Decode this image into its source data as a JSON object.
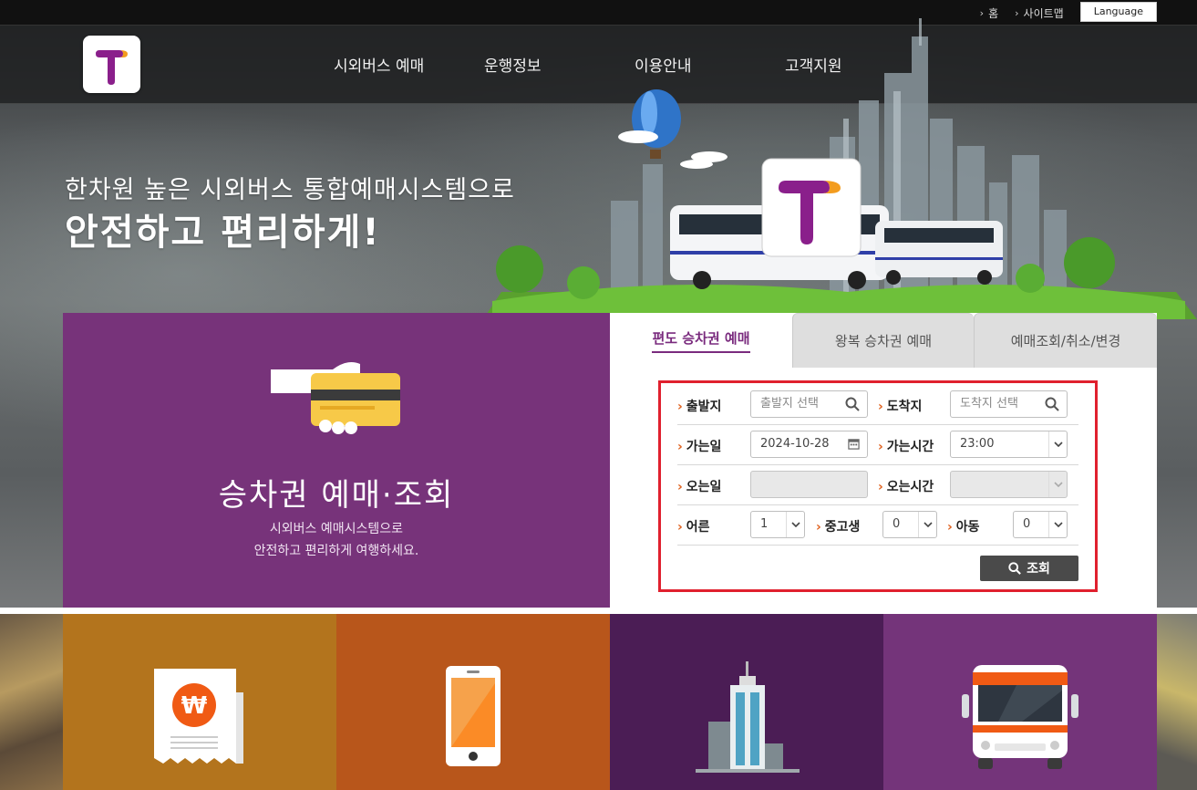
{
  "topbar": {
    "home_label": "홈",
    "sitemap_label": "사이트맵",
    "language_label": "Language"
  },
  "nav": {
    "items": [
      {
        "label": "시외버스 예매"
      },
      {
        "label": "운행정보"
      },
      {
        "label": "이용안내"
      },
      {
        "label": "고객지원"
      }
    ]
  },
  "hero": {
    "subtitle": "한차원 높은 시외버스 통합예매시스템으로",
    "title": "안전하고 편리하게!"
  },
  "promo_panel": {
    "title": "승차권 예매·조회",
    "desc_line1": "시외버스 예매시스템으로",
    "desc_line2": "안전하고 편리하게 여행하세요.",
    "icon": "card-payment-icon"
  },
  "tabs": [
    {
      "label": "편도 승차권 예매",
      "active": true
    },
    {
      "label": "왕복 승차권 예매",
      "active": false
    },
    {
      "label": "예매조회/취소/변경",
      "active": false
    }
  ],
  "form": {
    "departure_label": "출발지",
    "departure_placeholder": "출발지 선택",
    "arrival_label": "도착지",
    "arrival_placeholder": "도착지 선택",
    "go_date_label": "가는일",
    "go_date_value": "2024-10-28",
    "go_time_label": "가는시간",
    "go_time_value": "23:00",
    "return_date_label": "오는일",
    "return_time_label": "오는시간",
    "adult_label": "어른",
    "adult_value": "1",
    "youth_label": "중고생",
    "youth_value": "0",
    "child_label": "아동",
    "child_value": "0",
    "search_button": "조회"
  },
  "tiles": [
    {
      "icon": "receipt-won-icon"
    },
    {
      "icon": "mobile-phone-icon"
    },
    {
      "icon": "building-icon"
    },
    {
      "icon": "bus-front-icon"
    }
  ],
  "colors": {
    "purple": "#77337a",
    "tab_active": "#7a2b7e",
    "form_border": "#e0202e",
    "arrow_orange": "#e0621f",
    "tile1": "#b3741d",
    "tile2": "#b8561b",
    "tile3": "#4b1d55",
    "tile4": "#74347a"
  }
}
